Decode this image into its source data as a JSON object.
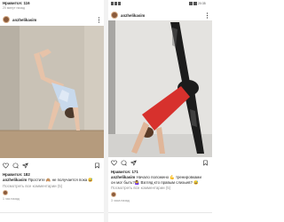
{
  "left": {
    "top_likes": "Нравится: 116",
    "top_time": "20 минут назад",
    "username": "anzhelikasim",
    "caption_text": "Простите 🙈 не получается пока 😅",
    "likes": "Нравится: 182",
    "view_comments": "Посмотреть все комментарии (5)",
    "time": "1 час назад",
    "colors": {
      "wall": "#c9c2b6",
      "floor": "#b59b7d"
    }
  },
  "right": {
    "status_time": "20:35",
    "username": "anzhelikasim",
    "likes": "Нравится: 171",
    "caption_line1": "Начало положено 💪 тренировками",
    "caption_line2": "он мог быть?🤷‍♀️ Взгляд кто правым слизьев? 😅",
    "view_comments": "Посмотреть все комментарии (5)",
    "time": "3 часа назад",
    "colors": {
      "wall": "#e4e3e0",
      "shirt": "#d7312d",
      "leggings": "#1c1c1c"
    }
  },
  "icons": [
    "heart-icon",
    "comment-icon",
    "share-icon",
    "bookmark-icon",
    "back-nav-icon",
    "home-nav-icon",
    "recent-nav-icon"
  ]
}
